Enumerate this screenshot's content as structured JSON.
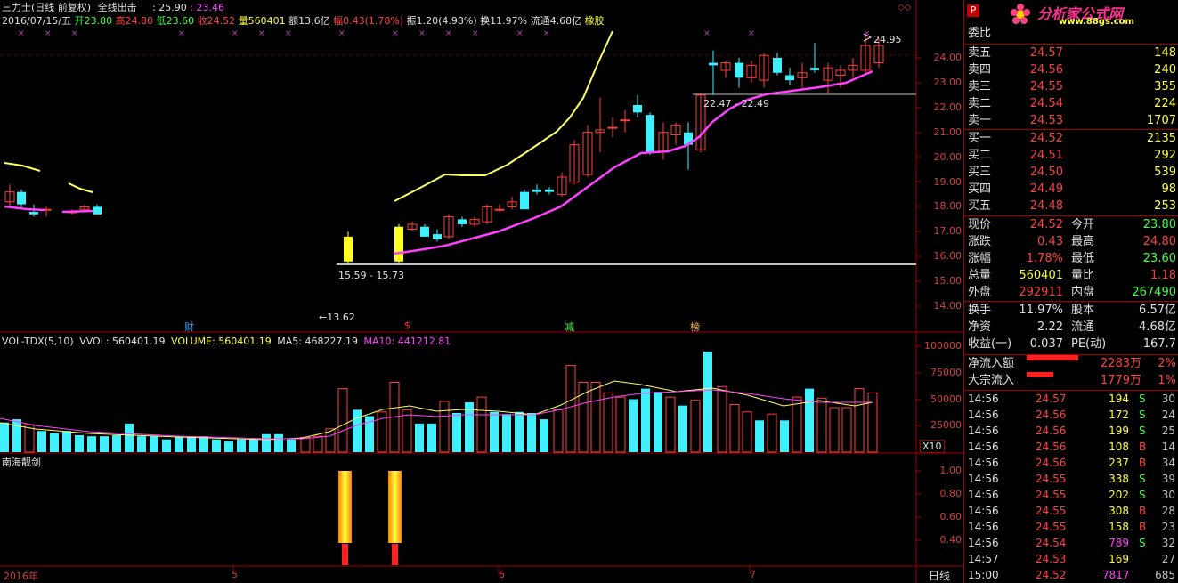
{
  "header": {
    "stock_name": "三力士(日线 前复权)",
    "indicator": "全线出击",
    "ind_val1": ": 25.90",
    "ind_val2": ": 23.46",
    "date": "2016/07/15/五",
    "open": "开23.80",
    "high": "高24.80",
    "low": "低23.60",
    "close": "收24.52",
    "volume": "量560401",
    "amount": "额13.6亿",
    "change": "幅0.43(1.78%)",
    "amplitude": "振1.20(4.98%)",
    "turnover": "换11.97%",
    "float": "流通4.68亿",
    "sector": "橡胶"
  },
  "main_chart": {
    "yticks": [
      "24.00",
      "23.00",
      "22.00",
      "21.00",
      "20.00",
      "19.00",
      "18.00",
      "17.00",
      "16.00",
      "15.00",
      "14.00"
    ],
    "high_label": "24.95",
    "range_top": "22.47 - 22.49",
    "range_bottom": "15.59 - 15.73",
    "low_label": "←13.62",
    "markers": [
      "财",
      "$",
      "减",
      "榜"
    ]
  },
  "volume_panel": {
    "title": "VOL-TDX(5,10)",
    "vvol": "VVOL: 560401.19",
    "volume": "VOLUME: 560401.19",
    "ma5": "MA5: 468227.19",
    "ma10": "MA10: 441212.81",
    "yticks": [
      "100000",
      "75000",
      "50000",
      "25000"
    ],
    "unit": "X10"
  },
  "indicator_panel": {
    "title": "南海靓剑",
    "yticks": [
      "1.00",
      "0.80",
      "0.60",
      "0.40"
    ]
  },
  "x_axis": {
    "labels": [
      "2016年",
      "5",
      "6",
      "7"
    ],
    "period": "日线"
  },
  "colors": {
    "up": "#ff4040",
    "down": "#40e0ff",
    "ma": "#ff40ff",
    "yellow_line": "#ffff60",
    "bg": "#000000"
  },
  "quote": {
    "logo_title": "分析家公式网",
    "logo_url": "www.88gs.com",
    "p_icon": "P",
    "wei_bi": "委比",
    "asks": [
      {
        "label": "卖五",
        "price": "24.57",
        "vol": "148"
      },
      {
        "label": "卖四",
        "price": "24.56",
        "vol": "240"
      },
      {
        "label": "卖三",
        "price": "24.55",
        "vol": "355"
      },
      {
        "label": "卖二",
        "price": "24.54",
        "vol": "224"
      },
      {
        "label": "卖一",
        "price": "24.53",
        "vol": "1707"
      }
    ],
    "bids": [
      {
        "label": "买一",
        "price": "24.52",
        "vol": "2135"
      },
      {
        "label": "买二",
        "price": "24.51",
        "vol": "292"
      },
      {
        "label": "买三",
        "price": "24.50",
        "vol": "539"
      },
      {
        "label": "买四",
        "price": "24.49",
        "vol": "98"
      },
      {
        "label": "买五",
        "price": "24.48",
        "vol": "253"
      }
    ],
    "stats": [
      {
        "l1": "现价",
        "v1": "24.52",
        "l2": "今开",
        "v2": "23.80"
      },
      {
        "l1": "涨跌",
        "v1": "0.43",
        "l2": "最高",
        "v2": "24.80"
      },
      {
        "l1": "涨幅",
        "v1": "1.78%",
        "l2": "最低",
        "v2": "23.60"
      },
      {
        "l1": "总量",
        "v1": "560401",
        "l2": "量比",
        "v2": "1.18"
      },
      {
        "l1": "外盘",
        "v1": "292911",
        "l2": "内盘",
        "v2": "267490"
      }
    ],
    "stats2": [
      {
        "l1": "换手",
        "v1": "11.97%",
        "l2": "股本",
        "v2": "6.57亿"
      },
      {
        "l1": "净资",
        "v1": "2.22",
        "l2": "流通",
        "v2": "4.68亿"
      },
      {
        "l1": "收益(一)",
        "v1": "0.037",
        "l2": "PE(动)",
        "v2": "167.7"
      }
    ],
    "flows": [
      {
        "label": "净流入额",
        "value": "2283万",
        "pct": "2%"
      },
      {
        "label": "大宗流入",
        "value": "1779万",
        "pct": "1%"
      }
    ],
    "ticks": [
      {
        "time": "14:56",
        "price": "24.57",
        "vol": "194",
        "dir": "S",
        "cnt": "30"
      },
      {
        "time": "14:56",
        "price": "24.56",
        "vol": "172",
        "dir": "S",
        "cnt": "24"
      },
      {
        "time": "14:56",
        "price": "24.56",
        "vol": "199",
        "dir": "S",
        "cnt": "25"
      },
      {
        "time": "14:56",
        "price": "24.56",
        "vol": "108",
        "dir": "B",
        "cnt": "14"
      },
      {
        "time": "14:56",
        "price": "24.56",
        "vol": "237",
        "dir": "B",
        "cnt": "34"
      },
      {
        "time": "14:56",
        "price": "24.55",
        "vol": "338",
        "dir": "S",
        "cnt": "39"
      },
      {
        "time": "14:56",
        "price": "24.55",
        "vol": "202",
        "dir": "S",
        "cnt": "30"
      },
      {
        "time": "14:56",
        "price": "24.55",
        "vol": "308",
        "dir": "B",
        "cnt": "28"
      },
      {
        "time": "14:56",
        "price": "24.55",
        "vol": "158",
        "dir": "B",
        "cnt": "23"
      },
      {
        "time": "14:56",
        "price": "24.54",
        "vol": "789",
        "dir": "S",
        "cnt": "32"
      },
      {
        "time": "14:57",
        "price": "24.53",
        "vol": "169",
        "dir": "",
        "cnt": "27"
      },
      {
        "time": "15:00",
        "price": "24.52",
        "vol": "7817",
        "dir": "",
        "cnt": "685"
      }
    ]
  }
}
